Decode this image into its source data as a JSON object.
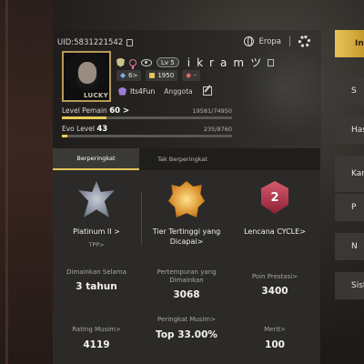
{
  "profile": {
    "uid": "UID:5831221542",
    "region": "Eropa",
    "avatar_tag": "LUCKY",
    "level_badge": "Lv 5",
    "player_name": "i k r a m ツ",
    "stat_1": "6>",
    "stat_2": "1950",
    "stat_3": "-",
    "clan_name": "Its4Fun",
    "clan_role": "Anggota",
    "player_level_label": "Level Pemain",
    "player_level_value": "60 >",
    "player_level_xp": "19581/74950",
    "player_level_progress": 0.26,
    "evo_level_label": "Evo Level",
    "evo_level_value": "43",
    "evo_level_xp": "235/8760",
    "evo_level_progress": 0.03
  },
  "tabs": [
    {
      "label": "Berperingkat",
      "active": true
    },
    {
      "label": "Tak Berperingkat",
      "active": false
    }
  ],
  "badges": [
    {
      "title": "Platinum II >",
      "sub": "TPP>"
    },
    {
      "title": "Tier Tertinggi yang Dicapai>",
      "sub": ""
    },
    {
      "title": "Lencana CYCLE>",
      "sub": "",
      "number": "2"
    }
  ],
  "stats": [
    {
      "label": "Dimainkan Selama",
      "value": "3 tahun"
    },
    {
      "label": "Pertempuran yang Dimainkan",
      "value": "3068"
    },
    {
      "label": "Poin Prestasi>",
      "value": "3400"
    },
    {
      "label": "Rating Musim>",
      "value": "4119"
    },
    {
      "label": "Peringkat Musim>",
      "value": "Top 33.00%"
    },
    {
      "label": "Merit>",
      "value": "100"
    }
  ],
  "right_menu": [
    {
      "label": "Info",
      "active": true
    },
    {
      "label": "S",
      "active": false
    },
    {
      "label": "Has",
      "active": false
    },
    {
      "label": "Kar",
      "active": false
    },
    {
      "label": "P",
      "active": false
    },
    {
      "label": "N",
      "active": false
    },
    {
      "label": "Sist",
      "active": false
    }
  ],
  "colors": {
    "accent": "#e6c55c",
    "panel": "#2b2a28",
    "cycle_badge": "#c8425a"
  }
}
